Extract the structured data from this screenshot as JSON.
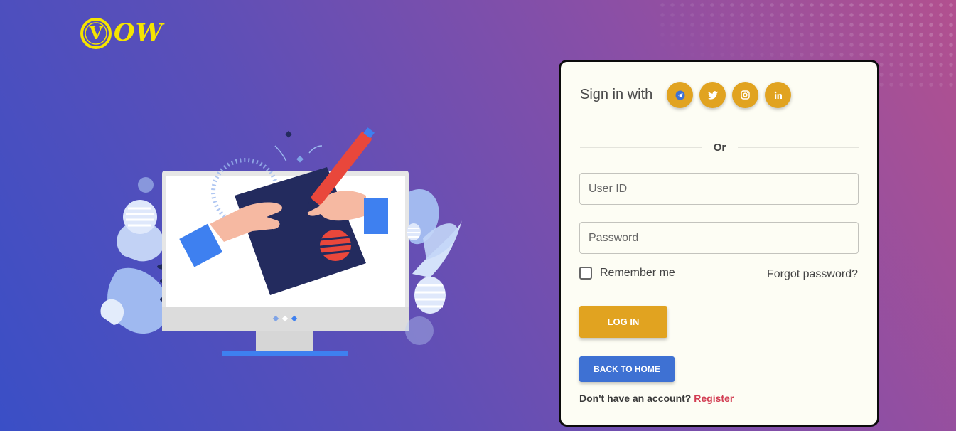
{
  "brand": {
    "logo_text": "OW",
    "logo_mark": "V",
    "logo_color": "#f5e400"
  },
  "login": {
    "signin_label": "Sign in with",
    "social": [
      {
        "name": "telegram",
        "icon": "telegram-icon"
      },
      {
        "name": "twitter",
        "icon": "twitter-icon"
      },
      {
        "name": "instagram",
        "icon": "instagram-icon"
      },
      {
        "name": "linkedin",
        "icon": "linkedin-icon"
      }
    ],
    "or_text": "Or",
    "user_id_placeholder": "User ID",
    "password_placeholder": "Password",
    "user_id_value": "",
    "password_value": "",
    "remember_label": "Remember me",
    "remember_checked": false,
    "forgot_label": "Forgot password?",
    "login_button": "LOG IN",
    "home_button": "BACK TO HOME",
    "no_account_text": "Don't have an account?",
    "register_link": "Register"
  },
  "colors": {
    "accent": "#e1a320",
    "secondary": "#3e71d3",
    "link": "#d23d52",
    "card_bg": "#fdfdf4"
  }
}
